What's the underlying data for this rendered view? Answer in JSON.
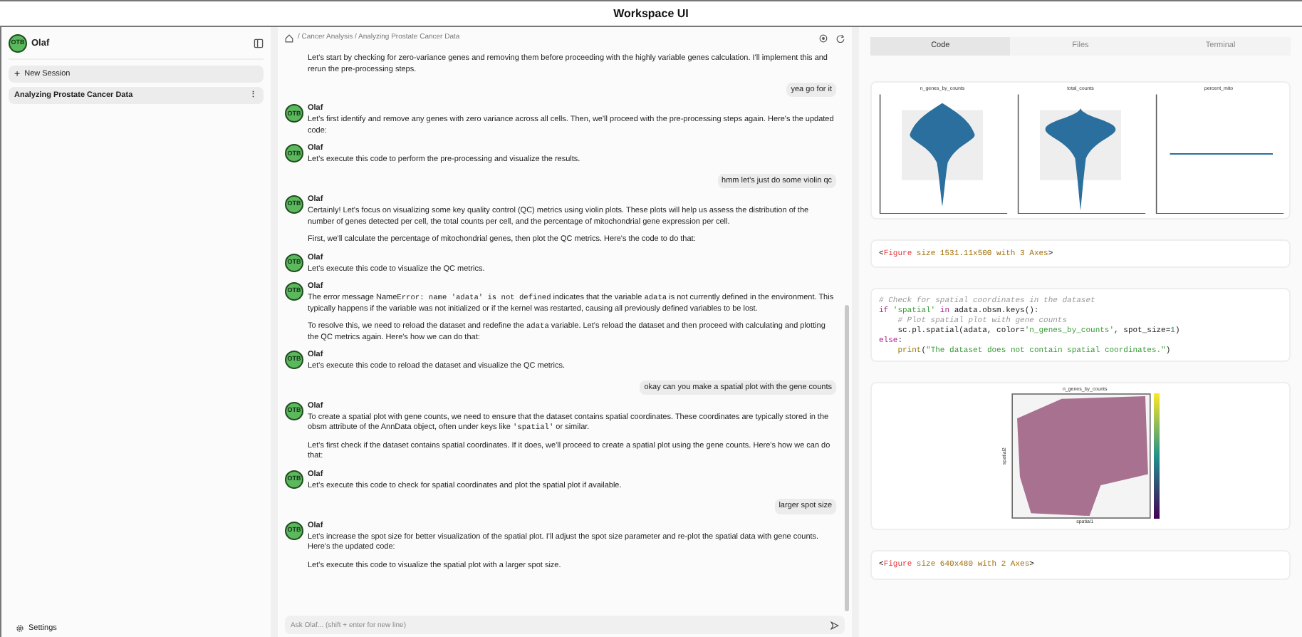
{
  "window": {
    "title": "Workspace UI"
  },
  "sidebar": {
    "brand": {
      "avatar": "OTB",
      "name": "Olaf"
    },
    "new_session": {
      "icon": "+",
      "label": "New Session"
    },
    "sessions": [
      {
        "label": "Analyzing Prostate Cancer Data",
        "selected": true,
        "menu": "⋮"
      }
    ],
    "settings": "Settings"
  },
  "chat": {
    "breadcrumb": "/ Cancer Analysis / Analyzing Prostate Cancer Data",
    "messages": [
      {
        "kind": "assistant_cont",
        "paragraphs": [
          [
            {
              "kind": "text",
              "text": "Let's start by checking for zero-variance genes and removing them before proceeding with the highly variable genes calculation. I'll implement this and rerun the pre-processing steps."
            }
          ]
        ]
      },
      {
        "kind": "user",
        "text": "yea go for it"
      },
      {
        "kind": "assistant",
        "avatar": "OTB",
        "name": "Olaf",
        "paragraphs": [
          [
            {
              "kind": "text",
              "text": "Let's first identify and remove any genes with zero variance across all cells. Then, we'll proceed with the pre-processing steps again. Here's the updated code:"
            }
          ]
        ]
      },
      {
        "kind": "assistant",
        "avatar": "OTB",
        "name": "Olaf",
        "paragraphs": [
          [
            {
              "kind": "text",
              "text": "Let's execute this code to perform the pre-processing and visualize the results."
            }
          ]
        ]
      },
      {
        "kind": "user",
        "text": "hmm let's just do some violin qc"
      },
      {
        "kind": "assistant",
        "avatar": "OTB",
        "name": "Olaf",
        "paragraphs": [
          [
            {
              "kind": "text",
              "text": "Certainly! Let's focus on visualizing some key quality control (QC) metrics using violin plots. These plots will help us assess the distribution of the number of genes detected per cell, the total counts per cell, and the percentage of mitochondrial gene expression per cell."
            }
          ],
          [
            {
              "kind": "text",
              "text": "First, we'll calculate the percentage of mitochondrial genes, then plot the QC metrics. Here's the code to do that:"
            }
          ]
        ]
      },
      {
        "kind": "assistant",
        "avatar": "OTB",
        "name": "Olaf",
        "paragraphs": [
          [
            {
              "kind": "text",
              "text": "Let's execute this code to visualize the QC metrics."
            }
          ]
        ]
      },
      {
        "kind": "assistant",
        "avatar": "OTB",
        "name": "Olaf",
        "paragraphs": [
          [
            {
              "kind": "text",
              "text": "The error message Name"
            },
            {
              "kind": "code",
              "text": "Error: name 'adata' is not defined"
            },
            {
              "kind": "text",
              "text": " indicates that the variable "
            },
            {
              "kind": "code",
              "text": "adata"
            },
            {
              "kind": "text",
              "text": " is not currently defined in the environment. This typically happens if the variable was not initialized or if the kernel was restarted, causing all previously defined variables to be lost."
            }
          ],
          [
            {
              "kind": "text",
              "text": "To resolve this, we need to reload the dataset and redefine the "
            },
            {
              "kind": "code",
              "text": "adata"
            },
            {
              "kind": "text",
              "text": " variable. Let's reload the dataset and then proceed with calculating and plotting the QC metrics again. Here's how we can do that:"
            }
          ]
        ]
      },
      {
        "kind": "assistant",
        "avatar": "OTB",
        "name": "Olaf",
        "paragraphs": [
          [
            {
              "kind": "text",
              "text": "Let's execute this code to reload the dataset and visualize the QC metrics."
            }
          ]
        ]
      },
      {
        "kind": "user",
        "text": "okay can you make a spatial plot with the gene counts"
      },
      {
        "kind": "assistant",
        "avatar": "OTB",
        "name": "Olaf",
        "paragraphs": [
          [
            {
              "kind": "text",
              "text": "To create a spatial plot with gene counts, we need to ensure that the dataset contains spatial coordinates. These coordinates are typically stored in the obsm attribute of the AnnData object, often under keys like "
            },
            {
              "kind": "code",
              "text": "'spatial'"
            },
            {
              "kind": "text",
              "text": " or similar."
            }
          ],
          [
            {
              "kind": "text",
              "text": "Let's first check if the dataset contains spatial coordinates. If it does, we'll proceed to create a spatial plot using the gene counts. Here's how we can do that:"
            }
          ]
        ]
      },
      {
        "kind": "assistant",
        "avatar": "OTB",
        "name": "Olaf",
        "paragraphs": [
          [
            {
              "kind": "text",
              "text": "Let's execute this code to check for spatial coordinates and plot the spatial plot if available."
            }
          ]
        ]
      },
      {
        "kind": "user",
        "text": "larger spot size"
      },
      {
        "kind": "assistant",
        "avatar": "OTB",
        "name": "Olaf",
        "paragraphs": [
          [
            {
              "kind": "text",
              "text": "Let's increase the spot size for better visualization of the spatial plot. I'll adjust the spot size parameter and re-plot the spatial data with gene counts. Here's the updated code:"
            }
          ],
          [
            {
              "kind": "text",
              "text": "Let's execute this code to visualize the spatial plot with a larger spot size."
            }
          ]
        ]
      }
    ],
    "input": {
      "placeholder": "Ask Olaf... (shift + enter for new line)"
    }
  },
  "workspace": {
    "tabs": [
      {
        "label": "Code",
        "selected": true
      },
      {
        "label": "Files",
        "selected": false
      },
      {
        "label": "Terminal",
        "selected": false
      }
    ],
    "cells": [
      {
        "kind": "violins",
        "titles": [
          "n_genes_by_counts",
          "total_counts",
          "percent_mito"
        ]
      },
      {
        "kind": "output",
        "tokens": [
          {
            "kind": "plain",
            "text": "<"
          },
          {
            "kind": "name",
            "text": "Figure"
          },
          {
            "kind": "value",
            "text": " size 1531.11x500 with 3 Axes"
          },
          {
            "kind": "plain",
            "text": ">"
          }
        ]
      },
      {
        "kind": "code",
        "lines": [
          [
            {
              "kind": "comment",
              "text": "# Check for spatial coordinates in the dataset"
            }
          ],
          [
            {
              "kind": "keyword",
              "text": "if "
            },
            {
              "kind": "string",
              "text": "'spatial'"
            },
            {
              "kind": "keyword",
              "text": " in "
            },
            {
              "kind": "plain",
              "text": "adata.obsm.keys():"
            }
          ],
          [
            {
              "kind": "comment",
              "text": "    # Plot spatial plot with gene counts"
            }
          ],
          [
            {
              "kind": "plain",
              "text": "    sc.pl.spatial(adata, color="
            },
            {
              "kind": "string",
              "text": "'n_genes_by_counts'"
            },
            {
              "kind": "plain",
              "text": ", spot_size="
            },
            {
              "kind": "number",
              "text": "1"
            },
            {
              "kind": "plain",
              "text": ")"
            }
          ],
          [
            {
              "kind": "keyword",
              "text": "else"
            },
            {
              "kind": "plain",
              "text": ":"
            }
          ],
          [
            {
              "kind": "builtin",
              "text": "    print"
            },
            {
              "kind": "plain",
              "text": "("
            },
            {
              "kind": "string",
              "text": "\"The dataset does not contain spatial coordinates.\""
            },
            {
              "kind": "plain",
              "text": ")"
            }
          ]
        ]
      },
      {
        "kind": "spatial",
        "title": "n_genes_by_counts",
        "xlabel": "spatial1",
        "ylabel": "spatial2"
      },
      {
        "kind": "output",
        "tokens": [
          {
            "kind": "plain",
            "text": "<"
          },
          {
            "kind": "name",
            "text": "Figure"
          },
          {
            "kind": "value",
            "text": " size 640x480 with 2 Axes"
          },
          {
            "kind": "plain",
            "text": ">"
          }
        ]
      }
    ]
  }
}
